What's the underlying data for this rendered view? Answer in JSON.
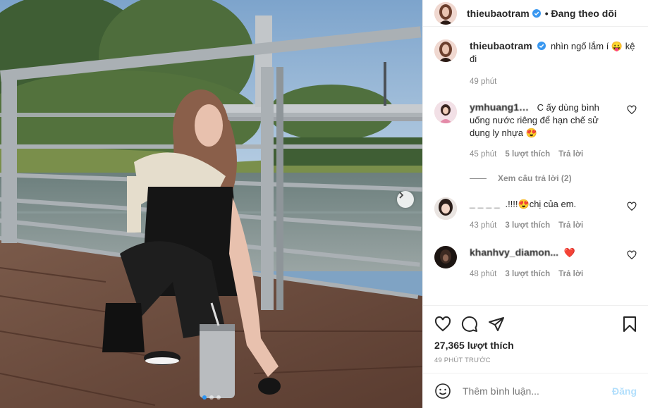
{
  "post": {
    "username": "thieubaotram",
    "follow_status": "• Đang theo dõi",
    "more_label": "···",
    "likes": "27,365 lượt thích",
    "timestamp": "49 PHÚT TRƯỚC",
    "add_comment_placeholder": "Thêm bình luận...",
    "post_label": "Đăng"
  },
  "caption": {
    "username": "thieubaotram",
    "text": "nhìn ngố lắm í 😛 kệ đi",
    "time": "49 phút"
  },
  "comments": [
    {
      "username": "ymhuang1…",
      "text": "C ấy dùng bình uống nước riêng để hạn chế sử dụng ly nhựa 😍",
      "time": "45 phút",
      "likes": "5 lượt thích",
      "reply": "Trả lời",
      "view_replies": "Xem câu trả lời (2)"
    },
    {
      "username": "_ _ _ _",
      "text": ".!!!!😍chị của em.",
      "time": "43 phút",
      "likes": "3 lượt thích",
      "reply": "Trả lời"
    },
    {
      "username": "khanhvy_diamon...",
      "text": "❤️",
      "time": "48 phút",
      "likes": "3 lượt thích",
      "reply": "Trả lời"
    }
  ],
  "carousel": {
    "total": 3,
    "active": 1
  },
  "colors": {
    "verified": "#3897f0",
    "link_disabled": "#b2dffc",
    "muted": "#8e8e8e"
  }
}
